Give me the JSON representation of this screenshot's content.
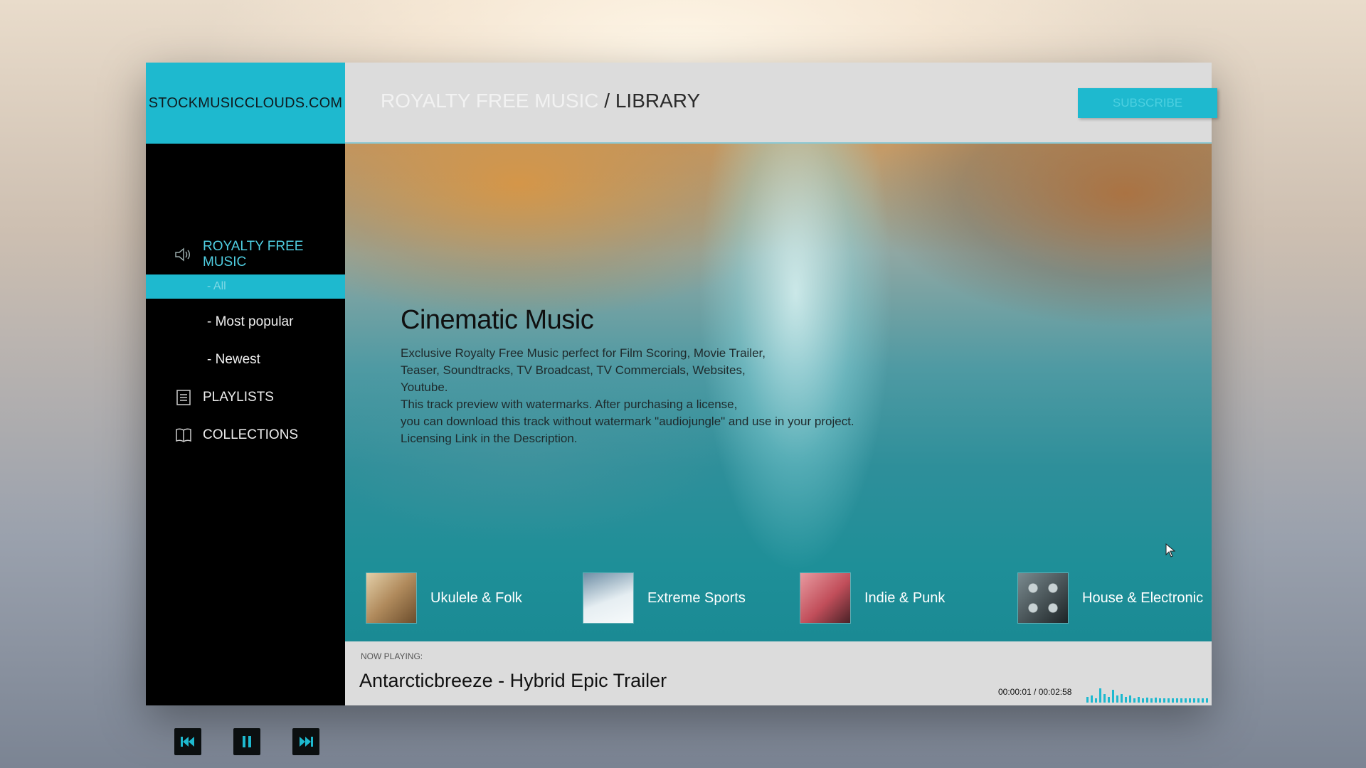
{
  "brand": {
    "name": "STOCKMUSICCLOUDS.COM"
  },
  "header": {
    "breadcrumb_section": "ROYALTY FREE MUSIC",
    "breadcrumb_separator": "/",
    "breadcrumb_page": "LIBRARY",
    "subscribe_label": "SUBSCRIBE"
  },
  "sidebar": {
    "royalty_label": "ROYALTY FREE MUSIC",
    "royalty_icon": "speaker-icon",
    "sub_items": [
      "- All",
      "- Most popular",
      "- Newest"
    ],
    "playlists_label": "PLAYLISTS",
    "playlists_icon": "list-icon",
    "collections_label": "COLLECTIONS",
    "collections_icon": "book-icon"
  },
  "hero": {
    "title": "Cinematic Music",
    "description": "Exclusive Royalty Free Music perfect for Film Scoring, Movie Trailer,\nTeaser,  Soundtracks, TV Broadcast, TV Commercials, Websites,\nYoutube.\n  This track preview with watermarks. After purchasing a license,\nyou can download this track without watermark \"audiojungle\" and use in your project.\n  Licensing Link in the Description."
  },
  "genres": [
    {
      "label": "Ukulele & Folk",
      "thumb_colors": [
        "#cbb08a",
        "#8a6a45"
      ]
    },
    {
      "label": "Extreme Sports",
      "thumb_colors": [
        "#e8eef2",
        "#4a6b7c"
      ]
    },
    {
      "label": "Indie & Punk",
      "thumb_colors": [
        "#c9606a",
        "#5a2c30"
      ]
    },
    {
      "label": "House & Electronic",
      "thumb_colors": [
        "#6d7b80",
        "#1f2527"
      ]
    }
  ],
  "now_playing": {
    "label": "NOW PLAYING:",
    "title": "Antarcticbreeze - Hybrid Epic Trailer",
    "time": "00:00:01 / 00:02:58"
  },
  "player_controls": {
    "previous_icon": "previous-icon",
    "pause_icon": "pause-icon",
    "next_icon": "next-icon"
  },
  "colors": {
    "accent": "#1eb9cf",
    "sidebar_bg": "#000000",
    "bar_bg": "#dcdcdc"
  }
}
